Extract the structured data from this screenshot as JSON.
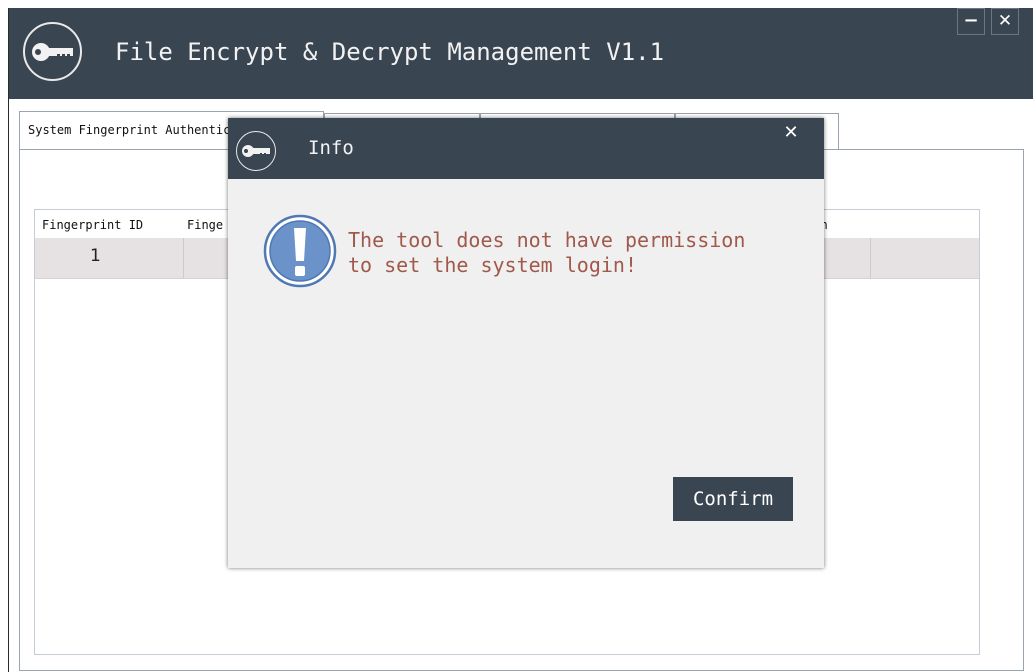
{
  "window": {
    "title": "File Encrypt & Decrypt Management V1.1",
    "minimize_symbol": "−",
    "close_symbol": "✕",
    "logo_icon": "key-icon"
  },
  "tabs": [
    {
      "label": "System Fingerprint Authentication"
    },
    {
      "label": ""
    },
    {
      "label": ""
    },
    {
      "label": ""
    }
  ],
  "fingerprint_table": {
    "columns": [
      "Fingerprint ID",
      "Finge",
      "gin"
    ],
    "rows": [
      {
        "id": "1"
      }
    ]
  },
  "dialog": {
    "title": "Info",
    "close_symbol": "✕",
    "icon": "exclamation-icon",
    "message": "The tool does not have permission to set the system login!",
    "confirm_label": "Confirm"
  },
  "colors": {
    "header": "#3a4552",
    "message_text": "#a0594a",
    "selected_row": "#e6e1e2",
    "info_icon_blue": "#5b86c0"
  }
}
